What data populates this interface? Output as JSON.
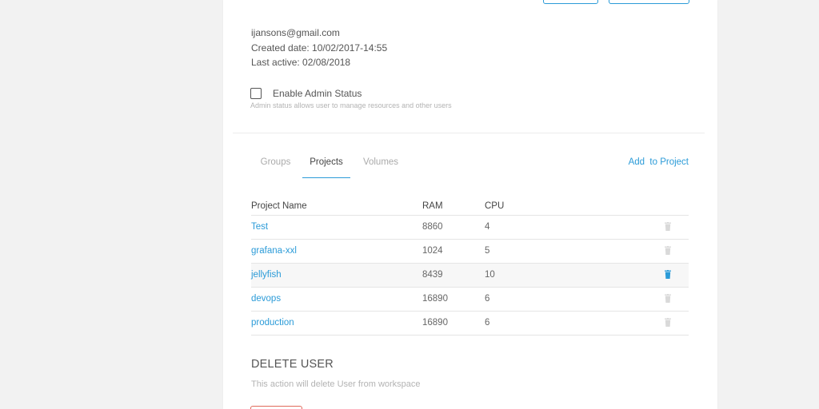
{
  "user": {
    "email": "ijansons@gmail.com",
    "created_date": "Created date: 10/02/2017-14:55",
    "last_active": "Last active: 02/08/2018"
  },
  "admin": {
    "label": "Enable Admin Status",
    "help": "Admin status allows user to manage resources and other users",
    "checked": false
  },
  "tabs": [
    {
      "label": "Groups",
      "active": false
    },
    {
      "label": "Projects",
      "active": true
    },
    {
      "label": "Volumes",
      "active": false
    }
  ],
  "add_to_project": "Add  to Project",
  "table": {
    "headers": {
      "name": "Project Name",
      "ram": "RAM",
      "cpu": "CPU"
    },
    "rows": [
      {
        "name": "Test",
        "ram": "8860",
        "cpu": "4"
      },
      {
        "name": "grafana-xxl",
        "ram": "1024",
        "cpu": "5"
      },
      {
        "name": "jellyfish",
        "ram": "8439",
        "cpu": "10",
        "hover": true
      },
      {
        "name": "devops",
        "ram": "16890",
        "cpu": "6"
      },
      {
        "name": "production",
        "ram": "16890",
        "cpu": "6"
      }
    ]
  },
  "delete_section": {
    "title": "DELETE USER",
    "description": "This action will delete User from workspace"
  },
  "colors": {
    "accent": "#2b9bd8",
    "danger": "#e06a5a",
    "trash_idle": "#d9d9d9"
  },
  "icons": {
    "row_delete": "trash-icon"
  }
}
